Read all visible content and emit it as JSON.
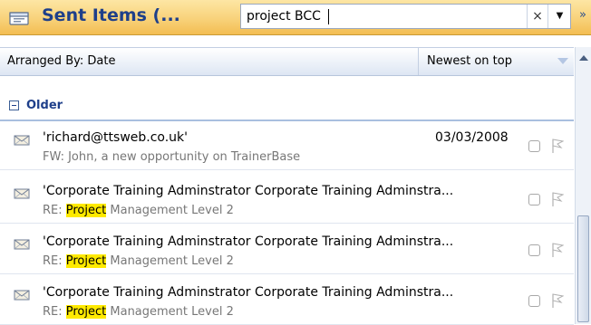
{
  "header": {
    "folder_title": "Sent Items (...",
    "search_value": "project BCC",
    "clear_glyph": "×",
    "dropdown_glyph": "▼",
    "expand_glyph": "»",
    "folder_icon": "folder-icon"
  },
  "arrange": {
    "label": "Arranged By: Date",
    "sort_order": "Newest on top"
  },
  "group": {
    "label": "Older"
  },
  "messages": [
    {
      "from": "'richard@ttsweb.co.uk'",
      "date": "03/03/2008",
      "subject": "FW: John, a new opportunity on TrainerBase"
    },
    {
      "from": "'Corporate Training Adminstrator Corporate Training Adminstra...",
      "subject_prefix": "RE: ",
      "subject_highlight": "Project",
      "subject_rest": " Management Level 2"
    },
    {
      "from": "'Corporate Training Adminstrator Corporate Training Adminstra...",
      "subject_prefix": "RE: ",
      "subject_highlight": "Project",
      "subject_rest": " Management Level 2"
    },
    {
      "from": "'Corporate Training Adminstrator Corporate Training Adminstra...",
      "subject_prefix": "RE: ",
      "subject_highlight": "Project",
      "subject_rest": " Management Level 2"
    }
  ],
  "colors": {
    "header_gold": "#f8d27a",
    "title_blue": "#1e3f8a",
    "highlight": "#ffea00"
  }
}
